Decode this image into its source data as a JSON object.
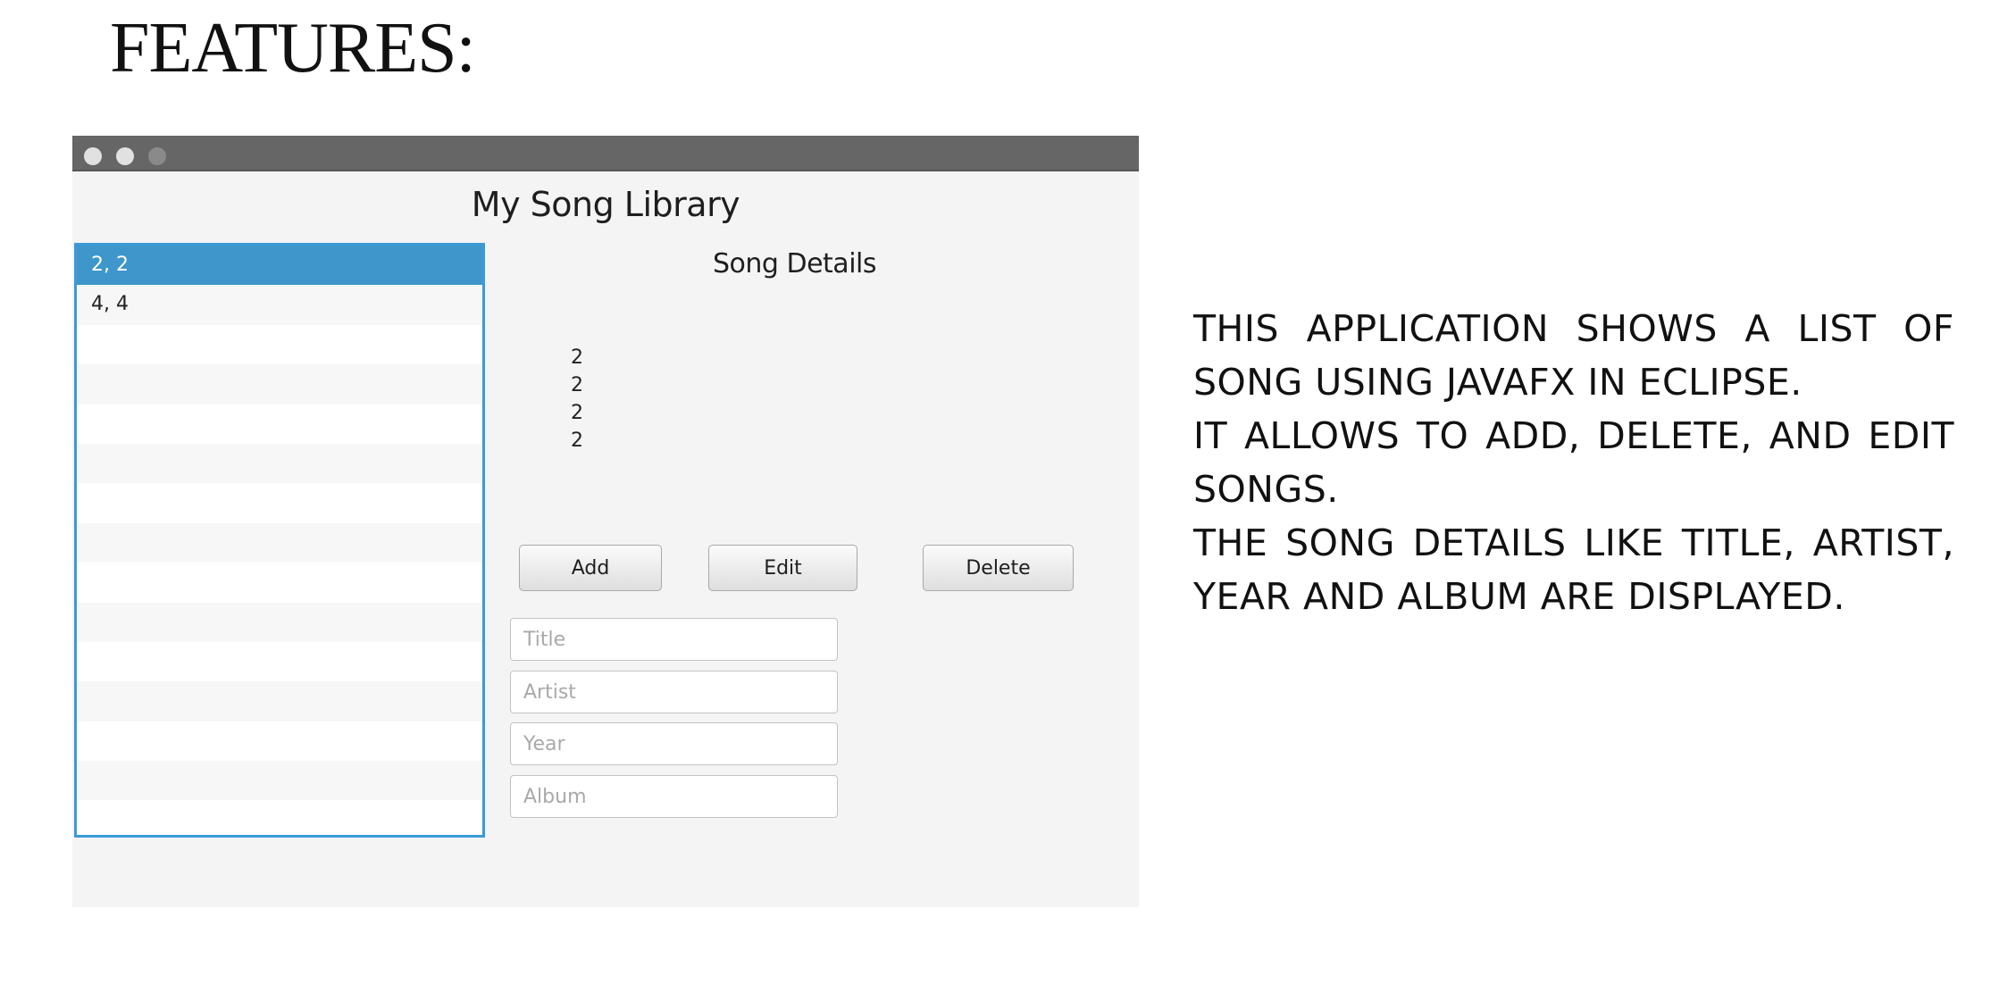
{
  "slide": {
    "heading": "FEATURES:",
    "description": [
      "THIS APPLICATION SHOWS A LIST OF SONG USING JAVAFX IN ECLIPSE.",
      "IT ALLOWS TO ADD, DELETE, AND EDIT SONGS.",
      "THE SONG DETAILS LIKE TITLE, ARTIST, YEAR AND ALBUM ARE DISPLAYED."
    ]
  },
  "window": {
    "title": "My Song Library",
    "song_list": {
      "items": [
        "2, 2",
        "4, 4"
      ],
      "selected_index": 0
    },
    "details": {
      "title": "Song Details",
      "values": [
        "2",
        "2",
        "2",
        "2"
      ]
    },
    "buttons": {
      "add": "Add",
      "edit": "Edit",
      "delete": "Delete"
    },
    "fields": {
      "title": {
        "placeholder": "Title",
        "value": ""
      },
      "artist": {
        "placeholder": "Artist",
        "value": ""
      },
      "year": {
        "placeholder": "Year",
        "value": ""
      },
      "album": {
        "placeholder": "Album",
        "value": ""
      }
    }
  },
  "colors": {
    "selection": "#3e96cb",
    "list_border": "#3b9ad8",
    "titlebar": "#666666",
    "window_bg": "#f4f4f4"
  }
}
